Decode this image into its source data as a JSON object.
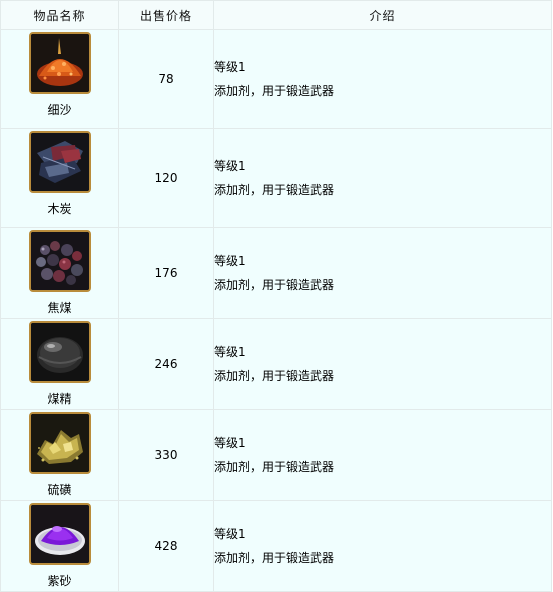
{
  "header": {
    "name_col": "物品名称",
    "price_col": "出售价格",
    "desc_col": "介绍"
  },
  "items": [
    {
      "name": "细沙",
      "price": "78",
      "desc_level": "等级1",
      "desc_text": "添加剂，用于锻造武器",
      "icon": "orange-sand-icon"
    },
    {
      "name": "木炭",
      "price": "120",
      "desc_level": "等级1",
      "desc_text": "添加剂，用于锻造武器",
      "icon": "charcoal-icon"
    },
    {
      "name": "焦煤",
      "price": "176",
      "desc_level": "等级1",
      "desc_text": "添加剂，用于锻造武器",
      "icon": "coke-pile-icon"
    },
    {
      "name": "煤精",
      "price": "246",
      "desc_level": "等级1",
      "desc_text": "添加剂，用于锻造武器",
      "icon": "jet-stone-icon"
    },
    {
      "name": "硫磺",
      "price": "330",
      "desc_level": "等级1",
      "desc_text": "添加剂，用于锻造武器",
      "icon": "sulfur-icon"
    },
    {
      "name": "紫砂",
      "price": "428",
      "desc_level": "等级1",
      "desc_text": "添加剂，用于锻造武器",
      "icon": "purple-sand-icon"
    }
  ]
}
